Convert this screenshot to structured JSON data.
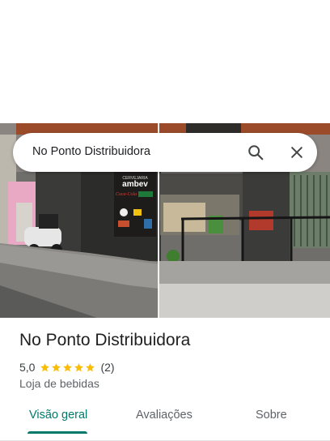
{
  "search": {
    "query": "No Ponto Distribuidora"
  },
  "photo": {
    "signs": {
      "top": "CERVEJARIA",
      "brand": "ambev",
      "coke": "Coca-Cola"
    }
  },
  "place": {
    "name": "No Ponto Distribuidora",
    "rating": "5,0",
    "stars": 5,
    "review_count": "(2)",
    "category": "Loja de bebidas"
  },
  "tabs": [
    {
      "label": "Visão geral",
      "active": true
    },
    {
      "label": "Avaliações",
      "active": false
    },
    {
      "label": "Sobre",
      "active": false
    }
  ],
  "colors": {
    "accent": "#00796b",
    "star": "#fbbc04"
  },
  "icons": [
    "search-icon",
    "close-icon",
    "star-icon"
  ]
}
